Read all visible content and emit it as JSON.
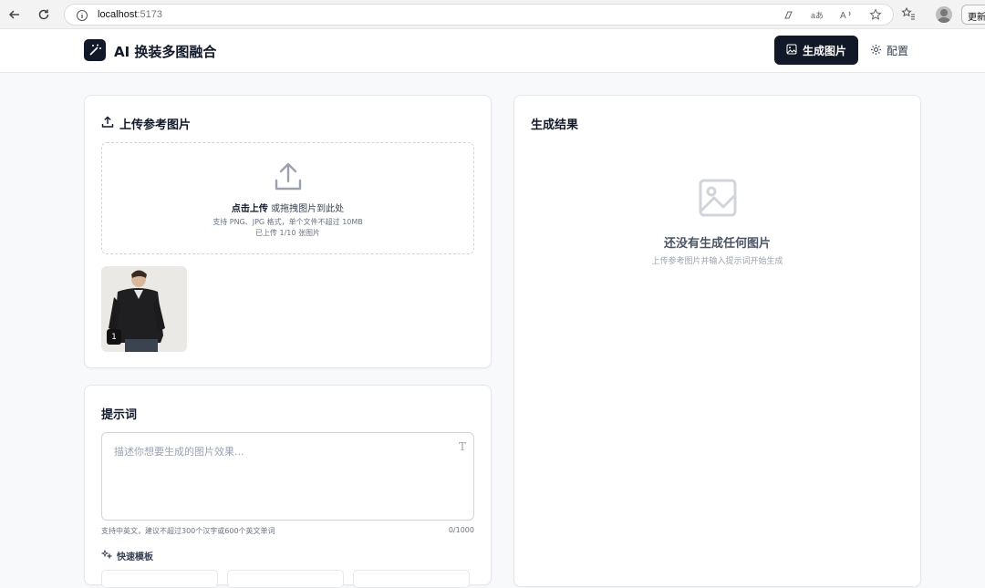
{
  "browser": {
    "url_host": "localhost",
    "url_port": ":5173",
    "update_label": "更新"
  },
  "header": {
    "title": "AI 换装多图融合",
    "generate_label": "生成图片",
    "config_label": "配置"
  },
  "upload": {
    "title": "上传参考图片",
    "click_text": "点击上传",
    "drag_text": " 或拖拽图片到此处",
    "formats": "支持 PNG、JPG 格式，单个文件不超过 10MB",
    "count": "已上传 1/10 张图片",
    "thumbnails": [
      {
        "badge": "1"
      }
    ]
  },
  "prompt": {
    "title": "提示词",
    "placeholder": "描述你想要生成的图片效果...",
    "hint": "支持中英文，建议不超过300个汉字或600个英文单词",
    "count": "0/1000",
    "templates_label": "快速模板"
  },
  "result": {
    "title": "生成结果",
    "empty_title": "还没有生成任何图片",
    "empty_subtitle": "上传参考图片并输入提示词开始生成"
  },
  "colors": {
    "primary": "#111827",
    "muted": "#9ca3af",
    "border": "#e5e7eb"
  }
}
